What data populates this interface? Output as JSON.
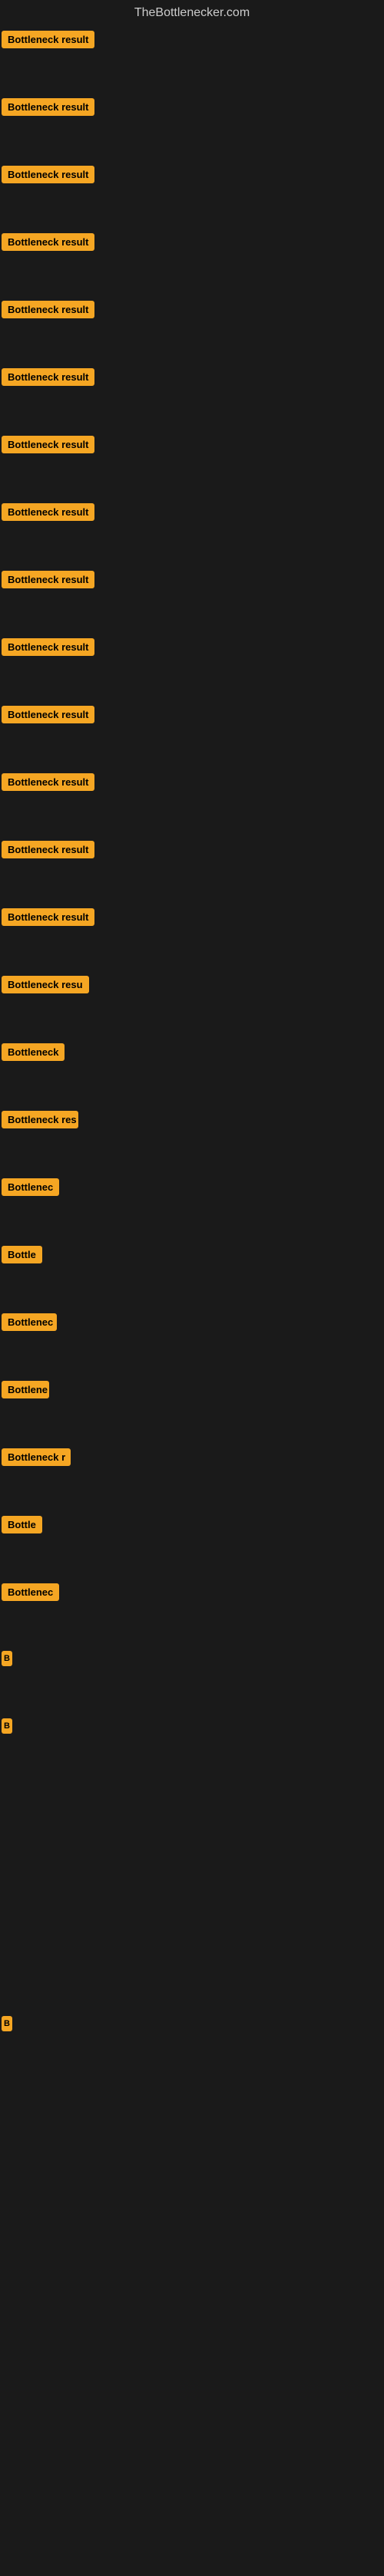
{
  "site": {
    "title": "TheBottlenecker.com"
  },
  "items": [
    {
      "id": 1,
      "label": "Bottleneck result",
      "class": "item-1"
    },
    {
      "id": 2,
      "label": "Bottleneck result",
      "class": "item-2"
    },
    {
      "id": 3,
      "label": "Bottleneck result",
      "class": "item-3"
    },
    {
      "id": 4,
      "label": "Bottleneck result",
      "class": "item-4"
    },
    {
      "id": 5,
      "label": "Bottleneck result",
      "class": "item-5"
    },
    {
      "id": 6,
      "label": "Bottleneck result",
      "class": "item-6"
    },
    {
      "id": 7,
      "label": "Bottleneck result",
      "class": "item-7"
    },
    {
      "id": 8,
      "label": "Bottleneck result",
      "class": "item-8"
    },
    {
      "id": 9,
      "label": "Bottleneck result",
      "class": "item-9"
    },
    {
      "id": 10,
      "label": "Bottleneck result",
      "class": "item-10"
    },
    {
      "id": 11,
      "label": "Bottleneck result",
      "class": "item-11"
    },
    {
      "id": 12,
      "label": "Bottleneck result",
      "class": "item-12"
    },
    {
      "id": 13,
      "label": "Bottleneck result",
      "class": "item-13"
    },
    {
      "id": 14,
      "label": "Bottleneck result",
      "class": "item-14"
    },
    {
      "id": 15,
      "label": "Bottleneck resu",
      "class": "item-15"
    },
    {
      "id": 16,
      "label": "Bottleneck",
      "class": "item-16"
    },
    {
      "id": 17,
      "label": "Bottleneck res",
      "class": "item-17"
    },
    {
      "id": 18,
      "label": "Bottlenec",
      "class": "item-18"
    },
    {
      "id": 19,
      "label": "Bottle",
      "class": "item-19"
    },
    {
      "id": 20,
      "label": "Bottlenec",
      "class": "item-20"
    },
    {
      "id": 21,
      "label": "Bottlene",
      "class": "item-21"
    },
    {
      "id": 22,
      "label": "Bottleneck r",
      "class": "item-22"
    },
    {
      "id": 23,
      "label": "Bottle",
      "class": "item-23"
    },
    {
      "id": 24,
      "label": "Bottlenec",
      "class": "item-24"
    },
    {
      "id": 25,
      "label": "B",
      "class": "item-25"
    },
    {
      "id": 26,
      "label": "B",
      "class": "item-26"
    }
  ],
  "late_item": {
    "label": "B"
  },
  "colors": {
    "badge_bg": "#f5a623",
    "badge_text": "#000000",
    "body_bg": "#1a1a1a",
    "title_color": "#cccccc"
  }
}
